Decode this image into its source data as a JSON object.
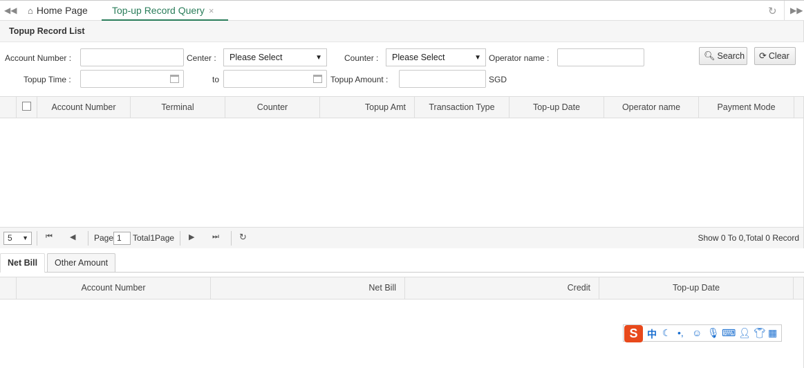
{
  "tabs": {
    "home_label": "Home Page",
    "active_label": "Top-up Record Query",
    "close_glyph": "×"
  },
  "panel": {
    "title": "Topup Record List"
  },
  "form": {
    "account_number_label": "Account Number :",
    "center_label": "Center :",
    "center_value": "Please Select",
    "counter_label": "Counter :",
    "counter_value": "Please Select",
    "operator_label": "Operator name :",
    "topup_time_label": "Topup Time :",
    "to_label": "to",
    "topup_amount_label": "Topup Amount :",
    "currency": "SGD",
    "search_label": "Search",
    "clear_label": "Clear"
  },
  "grid": {
    "columns": [
      "Account Number",
      "Terminal",
      "Counter",
      "Topup Amt",
      "Transaction Type",
      "Top-up Date",
      "Operator name",
      "Payment Mode"
    ],
    "rows": []
  },
  "pager": {
    "page_size": "5",
    "page_label": "Page",
    "page_value": "1",
    "total_label": "Total1Page",
    "info": "Show 0 To 0,Total 0 Record"
  },
  "bottom_tabs": [
    "Net Bill",
    "Other Amount"
  ],
  "grid2": {
    "columns": [
      "Account Number",
      "Net Bill",
      "Credit",
      "Top-up Date"
    ]
  },
  "ime": {
    "logo": "S",
    "mode": "中"
  },
  "colors": {
    "accent": "#2a7d5a",
    "ime_brand": "#e8491b",
    "ime_icons": "#1a6fd0"
  }
}
